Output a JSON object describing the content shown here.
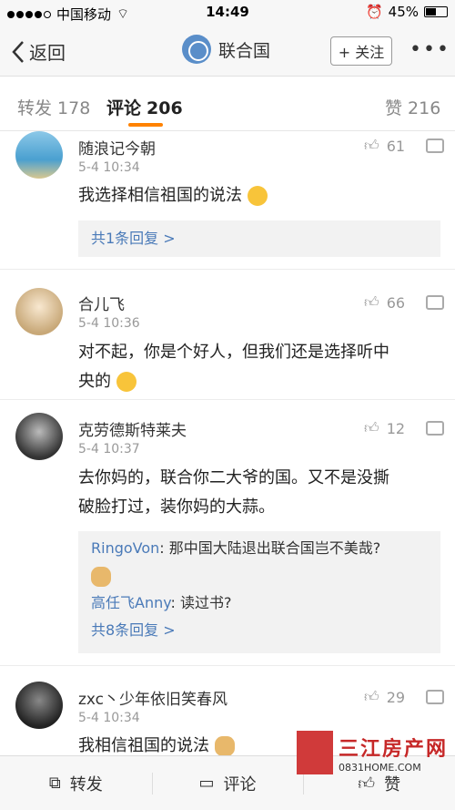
{
  "status": {
    "carrier": "中国移动",
    "time": "14:49",
    "battery": "45%"
  },
  "nav": {
    "back_label": "返回",
    "title": "联合国",
    "follow_label": "+ 关注",
    "more": "•••"
  },
  "tabs": {
    "repost_label": "转发",
    "repost_count": "178",
    "comment_label": "评论",
    "comment_count": "206",
    "like_label": "赞",
    "like_count": "216"
  },
  "comments": [
    {
      "name": "随浪记今朝",
      "time": "5-4 10:34",
      "text": "我选择相信祖国的说法",
      "likes": "61",
      "replies_link": "共1条回复 >"
    },
    {
      "name": "合儿飞",
      "time": "5-4 10:36",
      "text_line1": "对不起，你是个好人，但我们还是选择听中",
      "text_line2": "央的",
      "likes": "66"
    },
    {
      "name": "克劳德斯特莱夫",
      "time": "5-4 10:37",
      "text_line1": "去你妈的，联合你二大爷的国。又不是没撕",
      "text_line2": "破脸打过，装你妈的大蒜。",
      "likes": "12",
      "replies": [
        {
          "user": "RingoVon",
          "text": ": 那中国大陆退出联合国岂不美哉?"
        },
        {
          "user": "高任飞Anny",
          "text": ": 读过书?"
        }
      ],
      "replies_link": "共8条回复 >"
    },
    {
      "name": "zxc丶少年依旧笑春风",
      "time": "5-4 10:34",
      "text": "我相信祖国的说法",
      "likes": "29"
    }
  ],
  "bottom": {
    "repost": "转发",
    "comment": "评论",
    "like": "赞"
  },
  "watermark": {
    "name": "三江房产网",
    "url": "0831HOME.COM"
  }
}
